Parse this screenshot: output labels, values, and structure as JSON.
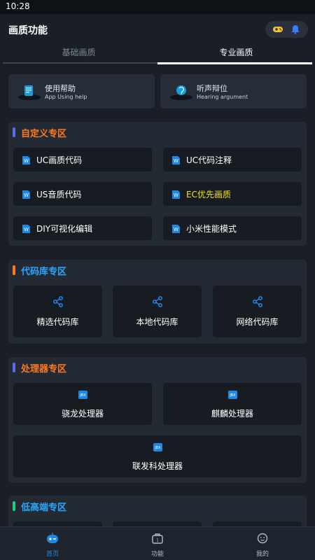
{
  "status": {
    "time": "10:28"
  },
  "header": {
    "title": "画质功能"
  },
  "tabs": [
    {
      "label": "基础画质",
      "active": false
    },
    {
      "label": "专业画质",
      "active": true
    }
  ],
  "help_cards": [
    {
      "title": "使用帮助",
      "subtitle": "App Using help",
      "icon": "help-book-icon"
    },
    {
      "title": "听声辩位",
      "subtitle": "Hearing argument",
      "icon": "hearing-icon"
    }
  ],
  "sections": {
    "custom": {
      "title": "自定义专区",
      "color": "#ff7a1a",
      "items": [
        {
          "label": "UC画质代码",
          "highlight": false
        },
        {
          "label": "UC代码注释",
          "highlight": false
        },
        {
          "label": "US音质代码",
          "highlight": false
        },
        {
          "label": "EC优先画质",
          "highlight": true
        },
        {
          "label": "DIY可视化编辑",
          "highlight": false
        },
        {
          "label": "小米性能模式",
          "highlight": false
        }
      ]
    },
    "repo": {
      "title": "代码库专区",
      "color": "#2aa7ff",
      "items": [
        {
          "label": "精选代码库"
        },
        {
          "label": "本地代码库"
        },
        {
          "label": "网络代码库"
        }
      ]
    },
    "processor": {
      "title": "处理器专区",
      "color": "#ff7a1a",
      "items": [
        {
          "label": "骁龙处理器"
        },
        {
          "label": "麒麟处理器"
        },
        {
          "label": "联发科处理器"
        }
      ]
    },
    "lowhigh": {
      "title": "低高端专区",
      "color": "#2aa7ff"
    }
  },
  "bottom_nav": [
    {
      "label": "首页",
      "active": true,
      "icon": "home-robot-icon"
    },
    {
      "label": "功能",
      "active": false,
      "icon": "toolbox-icon"
    },
    {
      "label": "我的",
      "active": false,
      "icon": "profile-face-icon"
    }
  ],
  "colors": {
    "accent_blue": "#1e88e5",
    "highlight_yellow": "#f5e31a",
    "bar_blue": "#5a6ee8",
    "bar_orange": "#ff7a1a",
    "bar_green": "#1ed07a"
  }
}
